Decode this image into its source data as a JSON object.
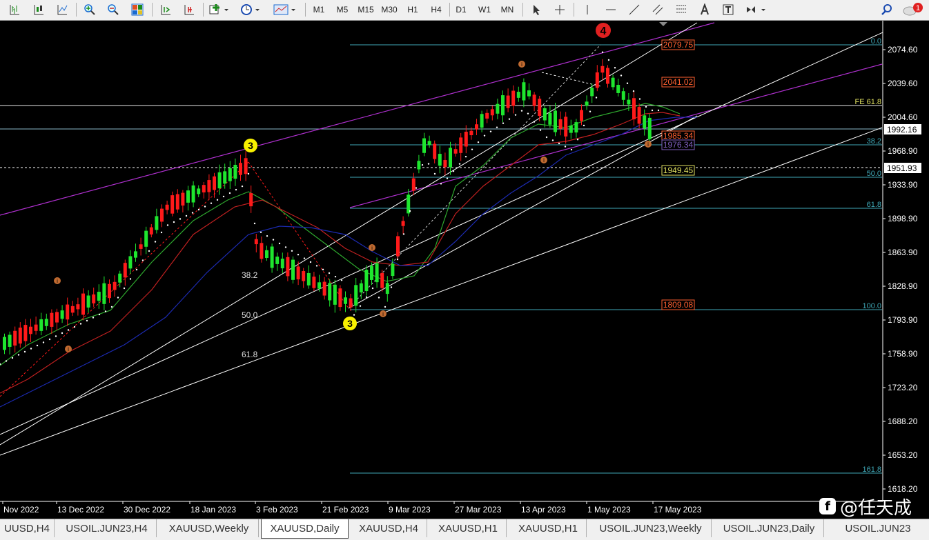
{
  "toolbar": {
    "timeframes": [
      "M1",
      "M5",
      "M15",
      "M30",
      "H1",
      "H4",
      "D1",
      "W1",
      "MN"
    ],
    "active_timeframe": "D1",
    "notification_count": "1"
  },
  "chart": {
    "symbol": "XAUUSD",
    "period": "Daily",
    "current_price": "1992.16",
    "crosshair_price": "1951.93",
    "price_ticks": [
      "2074.60",
      "2039.60",
      "2004.60",
      "1968.90",
      "1933.90",
      "1898.90",
      "1863.90",
      "1828.90",
      "1793.90",
      "1758.90",
      "1723.20",
      "1688.20",
      "1653.20",
      "1618.20"
    ],
    "date_ticks": [
      "Nov 2022",
      "13 Dec 2022",
      "30 Dec 2022",
      "18 Jan 2023",
      "3 Feb 2023",
      "21 Feb 2023",
      "9 Mar 2023",
      "27 Mar 2023",
      "13 Apr 2023",
      "1 May 2023",
      "17 May 2023"
    ],
    "fib_right_levels": [
      "0.0",
      "FE 61.8",
      "38.2",
      "50.0",
      "61.8",
      "100.0",
      "161.8"
    ],
    "fib_left_levels": [
      "38.2",
      "50.0",
      "61.8"
    ],
    "price_boxes": [
      "2079.75",
      "2041.02",
      "1985.34",
      "1976.34",
      "1949.45",
      "1809.08"
    ],
    "wave_labels": {
      "wave3_top": "3",
      "wave3_bottom": "3",
      "wave4": "4"
    },
    "minor_wave_label": "i"
  },
  "watermark": {
    "text": "@任天成",
    "logo": "f"
  },
  "tabs": [
    "UUSD,H4",
    "USOIL.JUN23,H4",
    "XAUUSD,Weekly",
    "XAUUSD,Daily",
    "XAUUSD,H4",
    "XAUUSD,H1",
    "XAUUSD,H1",
    "USOIL.JUN23,Weekly",
    "USOIL.JUN23,Daily",
    "USOIL.JUN23"
  ],
  "active_tab": "XAUUSD,Daily",
  "colors": {
    "bull": "#1ee62e",
    "bear": "#ff1a1a",
    "fib": "#3fa9b8",
    "channel": "#b030d0",
    "trend": "#ffffff",
    "ma_green": "#2ea82e",
    "ma_red": "#c02020",
    "ma_blue": "#1c2ab0",
    "price_box": "#ff6030"
  }
}
